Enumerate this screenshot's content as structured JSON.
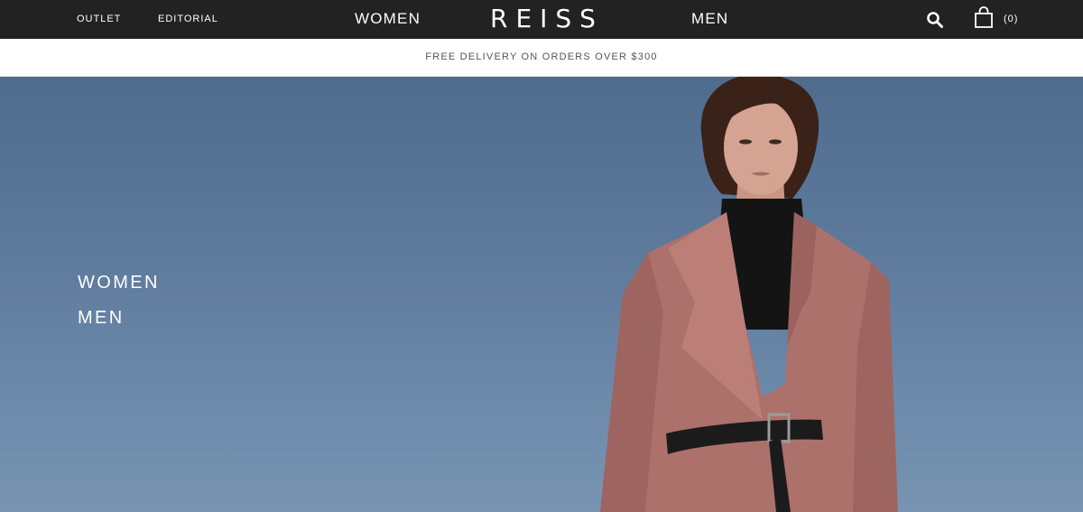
{
  "header": {
    "outlet": "OUTLET",
    "editorial": "EDITORIAL",
    "women": "WOMEN",
    "brand": "REISS",
    "men": "MEN",
    "bag_count": "(0)",
    "icons": [
      "search-icon",
      "shopping-bag-icon"
    ]
  },
  "promo": {
    "text": "FREE DELIVERY ON ORDERS OVER $300"
  },
  "hero": {
    "links": [
      "WOMEN",
      "MEN"
    ]
  },
  "colors": {
    "topbar": "#222222",
    "sky": "#5d7a9c",
    "coat": "#b0736e",
    "promo_text": "#555555"
  }
}
